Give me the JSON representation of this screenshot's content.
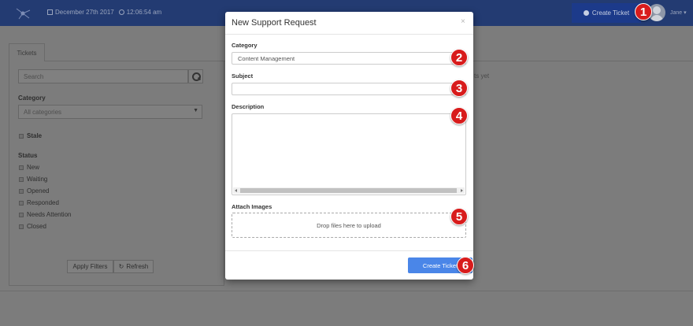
{
  "header": {
    "date": "December 27th 2017",
    "time": "12:06:54 am",
    "create_ticket_label": "Create Ticket",
    "user_name": "Jane"
  },
  "sidebar": {
    "tab_label": "Tickets",
    "search_placeholder": "Search",
    "category_label": "Category",
    "category_value": "All categories",
    "stale_label": "Stale",
    "status_label": "Status",
    "statuses": [
      "New",
      "Waiting",
      "Opened",
      "Responded",
      "Needs Attention",
      "Closed"
    ],
    "apply_filters_label": "Apply Filters",
    "refresh_label": "Refresh"
  },
  "main": {
    "empty_text": "ts yet"
  },
  "modal": {
    "title": "New Support Request",
    "close_glyph": "×",
    "category_label": "Category",
    "category_value": "Content Management",
    "subject_label": "Subject",
    "subject_value": "",
    "description_label": "Description",
    "description_value": "",
    "attach_label": "Attach Images",
    "dropzone_text": "Drop files here to upload",
    "submit_label": "Create Ticket"
  },
  "markers": [
    "1",
    "2",
    "3",
    "4",
    "5",
    "6"
  ],
  "colors": {
    "marker": "#d81c1c",
    "submit_button": "#4a86e8",
    "topbar": "#233b72"
  }
}
